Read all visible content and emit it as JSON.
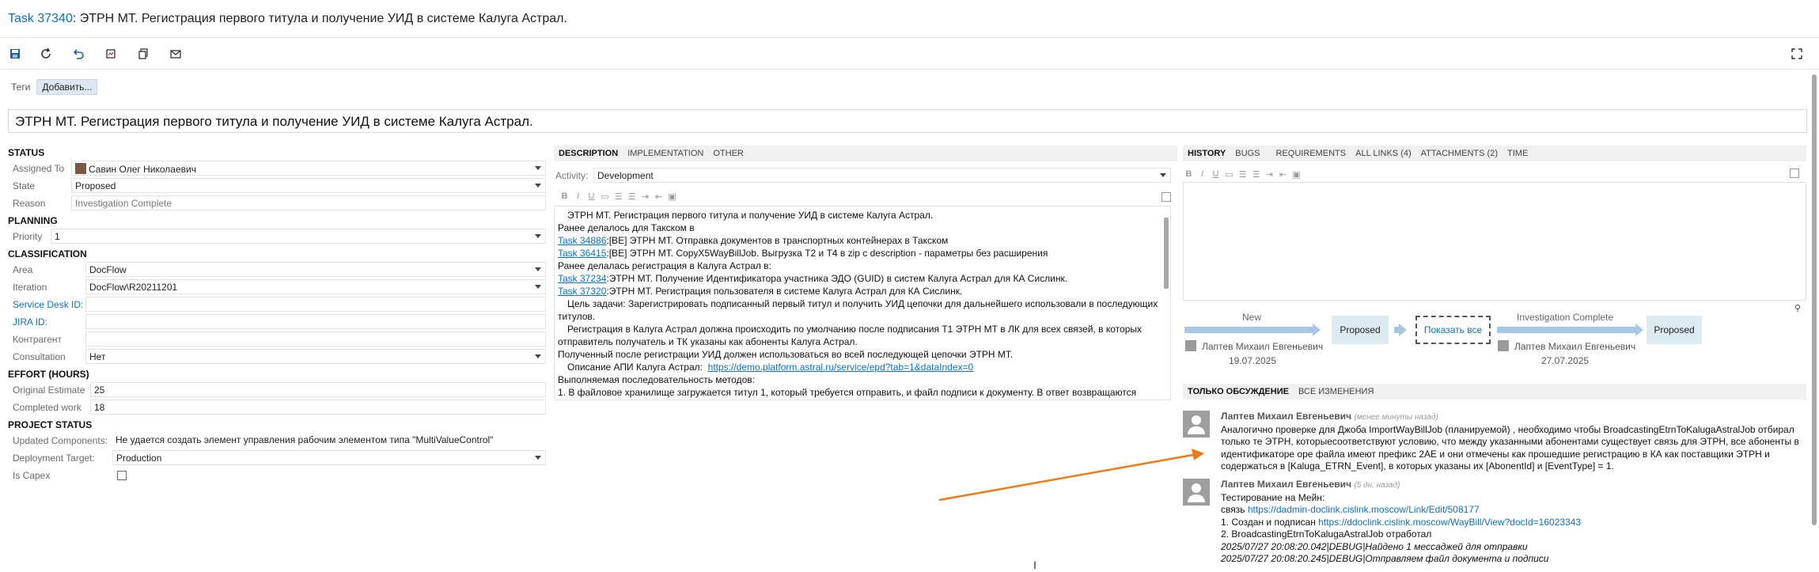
{
  "titlebar": {
    "task_id": "Task 37340",
    "title": ": ЭТРН МТ. Регистрация первого титула и получение УИД в системе Калуга Астрал."
  },
  "toolbar": {
    "icons": [
      "save-icon",
      "refresh-icon",
      "undo-icon",
      "capture-template-icon",
      "copy-icon",
      "email-icon",
      "fullscreen-icon"
    ]
  },
  "tags": {
    "label": "Теги",
    "add_label": "Добавить..."
  },
  "work_item_title": "ЭТРН МТ. Регистрация первого титула и получение УИД в системе Калуга Астрал.",
  "left": {
    "status": {
      "header": "STATUS",
      "assigned_to_label": "Assigned To",
      "assigned_to": "Савин Олег Николаевич",
      "state_label": "State",
      "state": "Proposed",
      "reason_label": "Reason",
      "reason": "Investigation Complete"
    },
    "planning": {
      "header": "PLANNING",
      "priority_label": "Priority",
      "priority": "1"
    },
    "classification": {
      "header": "CLASSIFICATION",
      "area_label": "Area",
      "area": "DocFlow",
      "iteration_label": "Iteration",
      "iteration": "DocFlow\\R20211201",
      "service_desk_label": "Service Desk ID:",
      "service_desk": "",
      "jira_label": "JIRA ID:",
      "jira": "",
      "contractor_label": "Контрагент",
      "contractor": "",
      "consultation_label": "Consultation",
      "consultation": "Нет"
    },
    "effort": {
      "header": "EFFORT (HOURS)",
      "original_label": "Original Estimate",
      "original": "25",
      "completed_label": "Completed work",
      "completed": "18"
    },
    "project": {
      "header": "PROJECT STATUS",
      "updated_label": "Updated Components:",
      "updated": "Не удается создать элемент управления рабочим элементом типа \"MultiValueControl\"",
      "deploy_label": "Deployment Target:",
      "deploy": "Production",
      "capex_label": "Is Capex"
    }
  },
  "middle": {
    "tabs": [
      "DESCRIPTION",
      "IMPLEMENTATION",
      "OTHER"
    ],
    "activity_label": "Activity:",
    "activity": "Development",
    "rte_buttons": [
      "B",
      "I",
      "U"
    ],
    "description": {
      "l1": "ЭТРН МТ. Регистрация первого титула и получение УИД в системе Калуга Астрал.",
      "l2": "Ранее делалось для Такском в",
      "l3_link": "Task 34886",
      "l3": ":[BE] ЭТРН МТ. Отправка документов в транспортных контейнерах в Такском",
      "l4_link": "Task 36415",
      "l4": ":[BE] ЭТРН МТ. CopyX5WayBillJob. Выгрузка Т2 и Т4 в zip с description - параметры без расширения",
      "l5": "Ранее делалась регистрация в Калуга Астрал в:",
      "l6_link": "Task 37234",
      "l6": ":ЭТРН МТ. Получение Идентификатора участника ЭДО (GUID) в систем Калуга Астрал для КА Сислинк.",
      "l7_link": "Task 37320",
      "l7": ":ЭТРН МТ. Регистрация пользователя в системе Калуга Астрал для КА Сислинк.",
      "l8": "Цель задачи: Зарегистрировать подписанный первый титул и получить УИД цепочки для дальнейшего использовали в последующих",
      "l9": "титулов.",
      "l10": "Регистрация в Калуга Астрал должна происходить по умолчанию после подписания Т1 ЭТРН МТ в ЛК для всех связей, в которых",
      "l11": "отправитель получатель и ТК указаны как абоненты Калуга Астрал.",
      "l12": "Полученный после регистрации УИД должен использоваться во всей последующей цепочки ЭТРН МТ.",
      "l13": "Описание АПИ Калуга Астрал:",
      "l13_link": "https://demo.platform.astral.ru/service/epd?tab=1&dataIndex=0",
      "l14": "Выполняемая последовательность методов:",
      "l15": "1. В файловое хранилище загружается титул 1, который требуется отправить, и файл подписи к документу. В ответ возвращаются"
    }
  },
  "right": {
    "tabs": [
      "HISTORY",
      "BUGS",
      "REQUIREMENTS",
      "ALL LINKS (4)",
      "ATTACHMENTS (2)",
      "TIME"
    ],
    "rte_buttons": [
      "B",
      "I",
      "U"
    ],
    "timeline": {
      "t1_label": "New",
      "t1_name": "Лаптев Михаил Евгеньевич",
      "t1_date": "19.07.2025",
      "state1": "Proposed",
      "show_all": "Показать все",
      "t2_label": "Investigation Complete",
      "t2_name": "Лаптев Михаил Евгеньевич",
      "t2_date": "27.07.2025",
      "state2": "Proposed"
    },
    "discussion_tabs": [
      "ТОЛЬКО ОБСУЖДЕНИЕ",
      "ВСЕ ИЗМЕНЕНИЯ"
    ],
    "comment1": {
      "author": "Лаптев Михаил Евгеньевич",
      "time": "(менее минуты назад)",
      "l1": "Аналогично проверке для Джоба ImportWayBillJob (планируемой) , необходимо чтобы BroadcastingEtrnToKalugaAstralJob  отбирал",
      "l2": "только те  ЭТРН, которыесоответствуют условию, что между указанными абонентами существует связь для ЭТРН, все абоненты в",
      "l3": "идентификаторе ope файла имеют префикс 2AE и они отмечены как прошедшие регистрацию в КА как поставщики ЭТРН и",
      "l4": "содержаться в [Kaluga_ETRN_Event], в которых указаны их [AbonentId] и [EventType] = 1."
    },
    "comment2": {
      "author": "Лаптев Михаил Евгеньевич",
      "time": "(5 дн. назад)",
      "l1": "Тестирование на Мейн:",
      "l2": "связь",
      "l2_link": "https://dadmin-doclink.cislink.moscow/Link/Edit/508177",
      "l3": "1. Создан и подписан",
      "l3_link": "https://ddoclink.cislink.moscow/WayBill/View?docId=16023343",
      "l4": "2. BroadcastingEtrnToKalugaAstralJob отработал",
      "l5": "2025/07/27 20:08:20.042|DEBUG|Найдено 1 мессаджей для отправки",
      "l6": "2025/07/27 20:08:20.245|DEBUG|Отправляем файл документа и подписи"
    }
  },
  "colors": {
    "link": "#0f6fc6",
    "state_box": "#dcecf2",
    "arrow": "#a8c6e6",
    "annotation": "#f07a18"
  }
}
